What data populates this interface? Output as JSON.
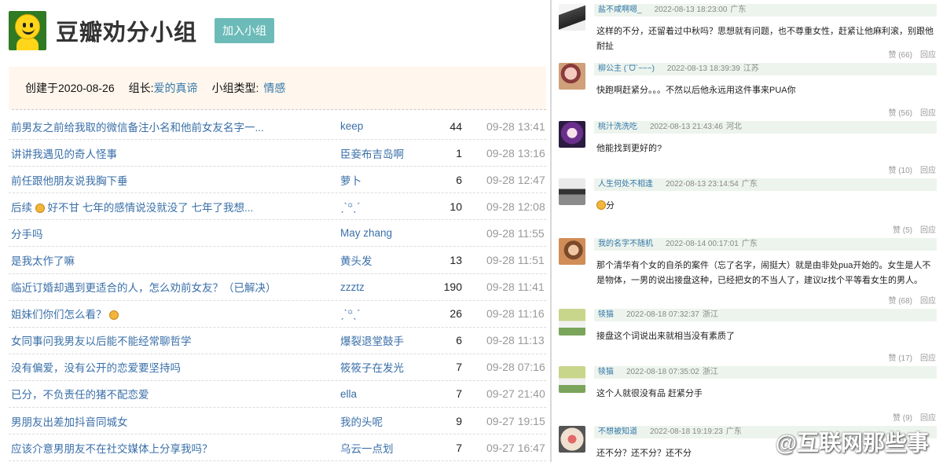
{
  "group": {
    "title": "豆瓣劝分小组",
    "join_label": "加入小组",
    "created_label": "创建于2020-08-26",
    "leader_label": "组长:",
    "leader_name": "爱的真谛",
    "type_label": "小组类型:",
    "type_value": "情感"
  },
  "topics": [
    {
      "title": "前男友之前给我取的微信备注小名和他前女友名字一...",
      "author": "keep",
      "count": "44",
      "time": "09-28 13:41"
    },
    {
      "title": "讲讲我遇见的奇人怪事",
      "author": "臣妾布吉岛啊",
      "count": "1",
      "time": "09-28 13:16"
    },
    {
      "title": "前任跟他朋友说我胸下垂",
      "author": "萝卜",
      "count": "6",
      "time": "09-28 12:47"
    },
    {
      "title": "后续",
      "title_after": " 好不甘 七年的感情说没就没了 七年了我想...",
      "author": "ˏˋ꙳ˎˊ",
      "count": "10",
      "time": "09-28 12:08"
    },
    {
      "title": "分手吗",
      "author": "May zhang",
      "count": "",
      "time": "09-28 11:55"
    },
    {
      "title": "是我太作了嘛",
      "author": "黄头发",
      "count": "13",
      "time": "09-28 11:51"
    },
    {
      "title": "临近订婚却遇到更适合的人，怎么劝前女友？（已解决）",
      "author": "zzztz",
      "count": "190",
      "time": "09-28 11:41"
    },
    {
      "title": "姐妹们你们怎么看？",
      "title_after": "",
      "author": "ˏˋ꙳ˎˊ",
      "count": "26",
      "time": "09-28 11:16"
    },
    {
      "title": "女同事问我男友以后能不能经常聊哲学",
      "author": "爆裂退堂鼓手",
      "count": "6",
      "time": "09-28 11:13"
    },
    {
      "title": "没有偏爱，没有公开的恋爱要坚持吗",
      "author": "筱筱子在发光",
      "count": "7",
      "time": "09-28 07:16"
    },
    {
      "title": "已分，不负责任的猪不配恋爱",
      "author": "ella",
      "count": "7",
      "time": "09-27 21:40"
    },
    {
      "title": "男朋友出差加抖音同城女",
      "author": "我的头呢",
      "count": "9",
      "time": "09-27 19:15"
    },
    {
      "title": "应该介意男朋友不在社交媒体上分享我吗？",
      "author": "乌云一点划",
      "count": "7",
      "time": "09-27 16:47"
    }
  ],
  "comments": [
    {
      "name": "盐不咸啊嗯_",
      "time": "2022-08-13 18:23:00",
      "loc": "广东",
      "content": "这样的不分，还留着过中秋吗？思想就有问题，也不尊重女性，赶紧让他麻利滚，别跟他耐扯",
      "likes": "赞 (66)",
      "reply": "回应"
    },
    {
      "name": "柳公主 (ˊᗜˋ~~~)",
      "time": "2022-08-13 18:39:39",
      "loc": "江苏",
      "content": "快跑啊赶紧分。。。不然以后他永远用这件事来PUA你",
      "likes": "赞 (56)",
      "reply": "回应"
    },
    {
      "name": "桃汁洗洗吃",
      "time": "2022-08-13 21:43:46",
      "loc": "河北",
      "content": "他能找到更好的?",
      "likes": "赞 (10)",
      "reply": "回应"
    },
    {
      "name": "人生何处不相逢",
      "time": "2022-08-13 23:14:54",
      "loc": "广东",
      "content": "分",
      "likes": "赞 (5)",
      "reply": "回应"
    },
    {
      "name": "我的名字不随机",
      "time": "2022-08-14 00:17:01",
      "loc": "广东",
      "content": "那个清华有个女的自杀的案件（忘了名字，闹挺大）就是由非处pua开始的。女生是人不是物体，一男的说出接盘这种，已经把女的不当人了，建议lz找个平等看女生的男人。",
      "likes": "赞 (68)",
      "reply": "回应"
    },
    {
      "name": "犊猫",
      "time": "2022-08-18 07:32:37",
      "loc": "浙江",
      "content": "接盘这个词说出来就相当没有素质了",
      "likes": "赞 (17)",
      "reply": "回应"
    },
    {
      "name": "犊猫",
      "time": "2022-08-18 07:35:02",
      "loc": "浙江",
      "content": "这个人就很没有品 赶紧分手",
      "likes": "赞 (9)",
      "reply": "回应"
    },
    {
      "name": "不想被知道",
      "time": "2022-08-18 19:19:23",
      "loc": "广东",
      "content": "还不分？还不分？还不分",
      "likes": "",
      "reply": ""
    }
  ],
  "watermark": "@互联网那些事"
}
